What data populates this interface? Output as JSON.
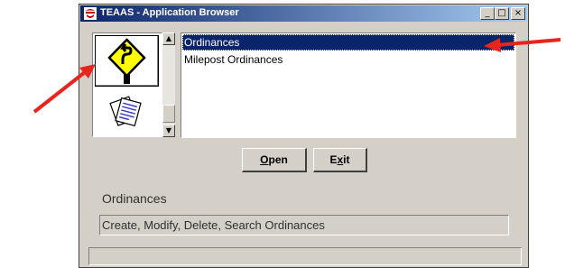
{
  "window": {
    "title": "TEAAS - Application Browser",
    "minimize_symbol": "_",
    "maximize_symbol": "□",
    "close_symbol": "×"
  },
  "icon_panel": {
    "items": [
      {
        "icon": "road-sign-icon",
        "selected": true
      },
      {
        "icon": "documents-icon",
        "selected": false
      }
    ]
  },
  "app_list": {
    "items": [
      {
        "label": "Ordinances",
        "selected": true
      },
      {
        "label": "Milepost Ordinances",
        "selected": false
      }
    ]
  },
  "buttons": {
    "open": {
      "label_underlined": "O",
      "label_rest": "pen"
    },
    "exit": {
      "label_first": "E",
      "label_underlined": "x",
      "label_rest": "it"
    }
  },
  "description": {
    "title": "Ordinances",
    "text": "Create, Modify, Delete, Search Ordinances"
  },
  "status": {
    "text": ""
  },
  "colors": {
    "annotation_arrow": "#e8241c",
    "selection": "#0a246a",
    "sign_yellow": "#ffff00"
  }
}
